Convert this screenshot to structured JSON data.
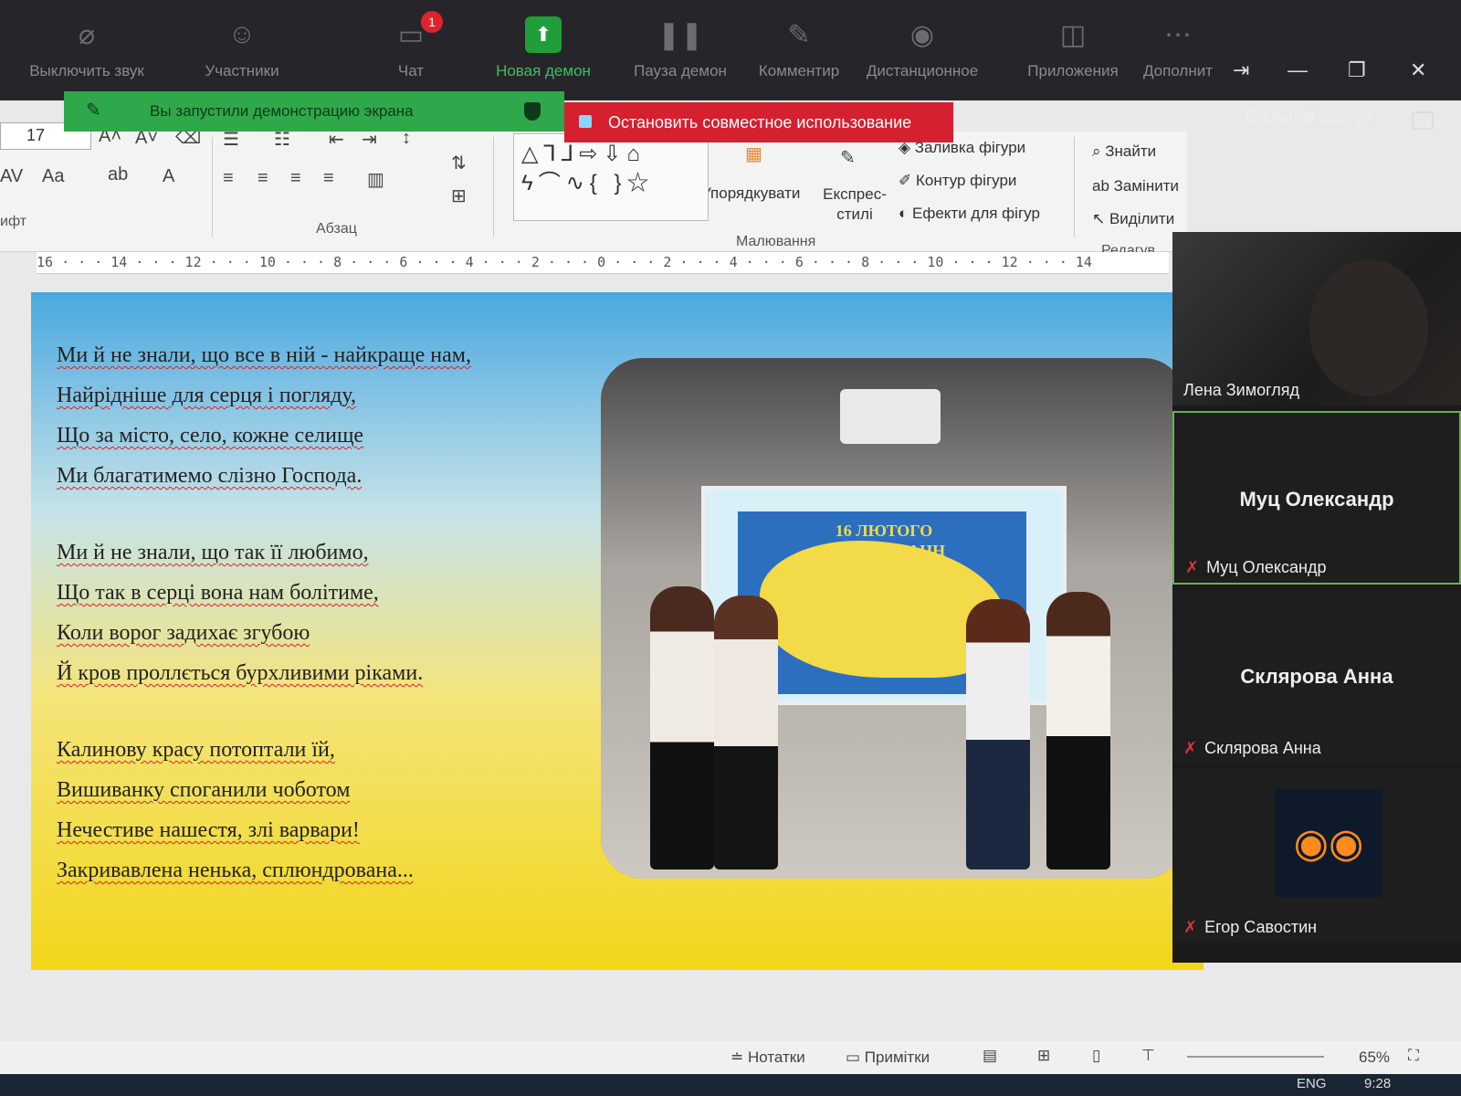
{
  "zoom_toolbar": {
    "buttons": [
      {
        "label": "Выключить звук",
        "icon": "mic-icon"
      },
      {
        "label": "Участники",
        "icon": "participants-icon"
      },
      {
        "label": "Чат",
        "icon": "chat-icon"
      },
      {
        "label": "Новая демон",
        "icon": "share-screen-icon"
      },
      {
        "label": "Пауза демон",
        "icon": "pause-icon"
      },
      {
        "label": "Комментир",
        "icon": "annotate-icon"
      },
      {
        "label": "Дистанционное",
        "icon": "remote-control-icon"
      },
      {
        "label": "Приложения",
        "icon": "apps-icon"
      },
      {
        "label": "Дополнит",
        "icon": "more-icon"
      }
    ],
    "chat_badge": "1"
  },
  "share_notice": "Вы запустили демонстрацию экрана",
  "stop_share": "Остановить совместное использование",
  "spilny_dostup": "Спільний доступ",
  "ribbon": {
    "font_size": "17",
    "groups": {
      "font": "ифт",
      "paragraph": "Абзац",
      "drawing": "Малювання",
      "editing": "Редагув"
    },
    "drawing": {
      "arrange": "Упорядкувати",
      "quick_styles": "Експрес-\nстилі",
      "shape_fill": "Заливка фігури",
      "shape_outline": "Контур фігури",
      "shape_effects": "Ефекти для фігур"
    },
    "editing": {
      "find": "Знайти",
      "replace": "Замінити",
      "select": "Виділити"
    }
  },
  "ruler": "16 · · · 14 · · · 12 · · · 10 · · · 8 · · · 6 · · · 4 · · · 2 · · · 0 · · · 2 · · · 4 · · · 6 · · · 8 · · · 10 · · · 12 · · · 14",
  "poem": {
    "stanza1": [
      "Ми й не знали, що все в ній - найкраще нам,",
      "Найрідніше для серця і погляду,",
      "Що за місто, село, кожне селище",
      "Ми благатимемо слізно Господа."
    ],
    "stanza2": [
      "Ми й не знали, що так її любимо,",
      "Що так в серці вона нам болітиме,",
      "Коли ворог задихає згубою",
      "Й кров проллється бурхливими ріками."
    ],
    "stanza3": [
      "Калинову красу потоптали їй,",
      "Вишиванку споганили чоботом",
      "Нечестиве нашестя, злі варвари!",
      "Закривавлена ненька, сплюндрована..."
    ]
  },
  "photo_caption": "16 ЛЮТОГО\nДЕНЬ ЄДНАНН",
  "participants": [
    {
      "name": "Лена Зимогляд",
      "type": "video"
    },
    {
      "name": "Муц Олександр",
      "big": "Муц Олександр",
      "muted": true
    },
    {
      "name": "Склярова Анна",
      "big": "Склярова Анна",
      "muted": true
    },
    {
      "name": "Егор Савостин",
      "muted": true,
      "avatar": "owl-avatar-icon"
    }
  ],
  "status_bar": {
    "notes": "Нотатки",
    "comments": "Примітки",
    "zoom": "65%"
  },
  "taskbar": {
    "lang": "ENG",
    "time": "9:28"
  },
  "colors": {
    "share_green": "#2ea84a",
    "stop_red": "#d4202f",
    "zoom_dark": "#26262a"
  }
}
